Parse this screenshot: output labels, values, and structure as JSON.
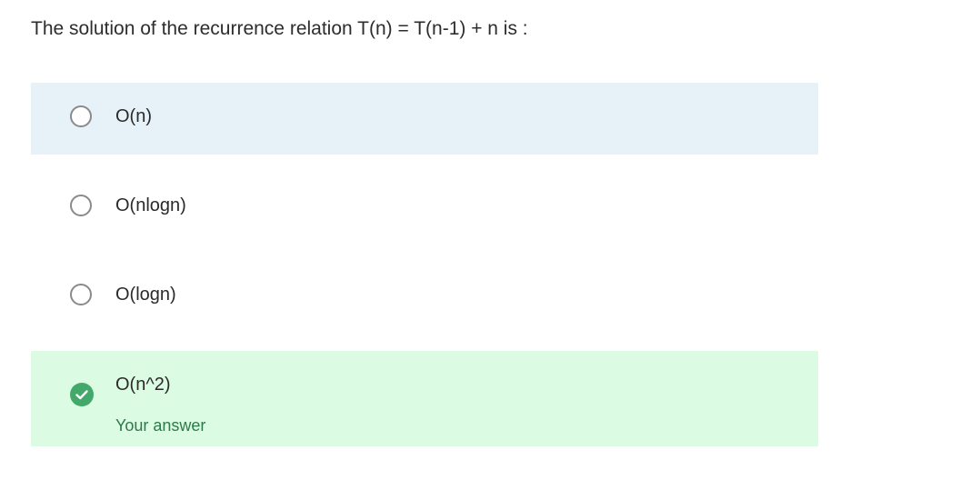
{
  "question": {
    "text": "The solution of the recurrence relation T(n) = T(n-1) + n is :"
  },
  "options": [
    {
      "label": "O(n)",
      "state": "hover",
      "background": "#e6f1f8"
    },
    {
      "label": "O(nlogn)",
      "state": "default",
      "background": "#ffffff"
    },
    {
      "label": "O(logn)",
      "state": "default",
      "background": "#ffffff"
    },
    {
      "label": "O(n^2)",
      "state": "selected-correct",
      "background": "#dcfbe3",
      "feedback": "Your answer"
    }
  ],
  "colors": {
    "correct_check": "#43a96b",
    "feedback_text": "#2f7a4a",
    "hover_background": "#e6f1f8",
    "correct_background": "#dcfbe3"
  },
  "icons": {
    "unselected": "radio-circle-icon",
    "selected_correct": "checkmark-circle-icon"
  }
}
